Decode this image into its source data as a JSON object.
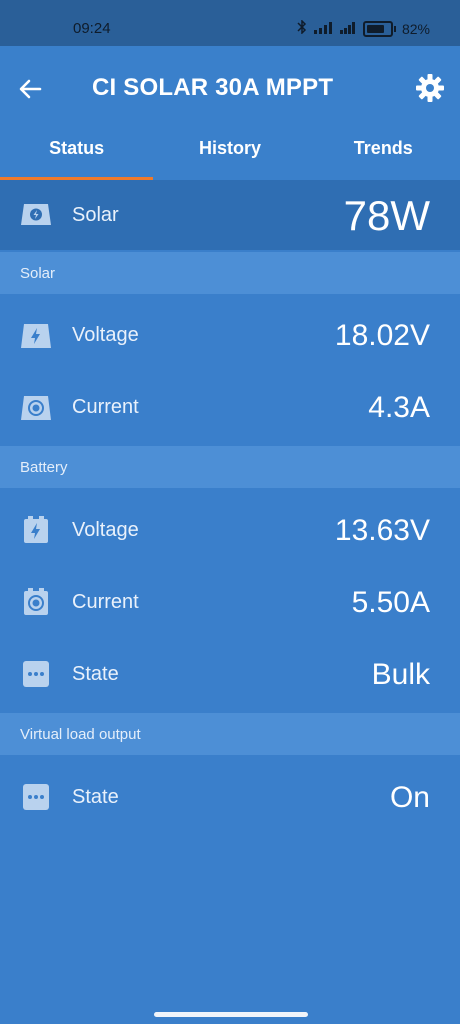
{
  "status_bar": {
    "time": "09:24",
    "battery": "82%"
  },
  "header": {
    "title": "CI SOLAR 30A MPPT"
  },
  "tabs": [
    {
      "label": "Status",
      "active": true
    },
    {
      "label": "History",
      "active": false
    },
    {
      "label": "Trends",
      "active": false
    }
  ],
  "hero": {
    "label": "Solar",
    "value": "78W"
  },
  "sections": {
    "solar": {
      "title": "Solar",
      "voltage": {
        "label": "Voltage",
        "value": "18.02V"
      },
      "current": {
        "label": "Current",
        "value": "4.3A"
      }
    },
    "battery": {
      "title": "Battery",
      "voltage": {
        "label": "Voltage",
        "value": "13.63V"
      },
      "current": {
        "label": "Current",
        "value": "5.50A"
      },
      "state": {
        "label": "State",
        "value": "Bulk"
      }
    },
    "load": {
      "title": "Virtual load output",
      "state": {
        "label": "State",
        "value": "On"
      }
    }
  },
  "colors": {
    "background": "#3a7fcb",
    "hero_bg": "#2f6eb3",
    "section_bg": "#4d8fd6",
    "accent": "#f07a2a"
  }
}
